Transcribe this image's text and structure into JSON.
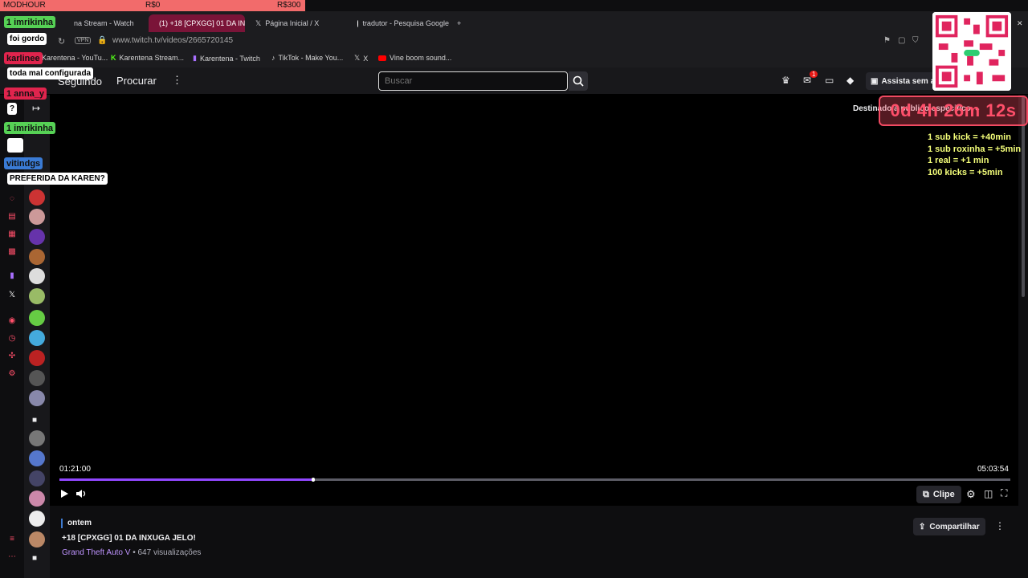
{
  "goal": {
    "left": "MODHOUR",
    "mid": "R$0",
    "right": "R$300"
  },
  "tabs": [
    {
      "label": "na Stream - Watch"
    },
    {
      "label": "(1) +18 [CPXGG] 01 DA IN"
    },
    {
      "label": "Página Inicial / X"
    },
    {
      "label": "tradutor - Pesquisa Google"
    }
  ],
  "url": {
    "vpn": "VPN",
    "address": "www.twitch.tv/videos/2665720145"
  },
  "bookmarks": [
    {
      "label": "Karentena - YouTu..."
    },
    {
      "label": "Karentena Stream..."
    },
    {
      "label": "Karentena - Twitch"
    },
    {
      "label": "TikTok - Make You..."
    },
    {
      "label": "X"
    },
    {
      "label": "Vine boom sound..."
    }
  ],
  "nav": {
    "following": "Seguindo",
    "browse": "Procurar",
    "search_placeholder": "Buscar",
    "notif_count": "1",
    "adfree": "Assista sem a"
  },
  "player": {
    "audience_label": "Destinado a público especifico",
    "time_current": "01:21:00",
    "time_total": "05:03:54",
    "progress_fraction": 0.267,
    "clip_label": "Clipe"
  },
  "video": {
    "date": "ontem",
    "title": "+18 [CPXGG] 01 DA INXUGA JELO!",
    "game": "Grand Theft Auto V",
    "views": " • 647 visualizações",
    "share_label": "Compartilhar"
  },
  "overlay": {
    "timer": "0d 4h 26m 12s",
    "rules": [
      "1 sub kick = +40min",
      "1 sub roxinha = +5min",
      "1 real = +1 min",
      "100 kicks = +5min"
    ]
  },
  "chat": [
    {
      "user": "imrikinha",
      "badge": "1",
      "color": "#56d155",
      "message": "foi gordo"
    },
    {
      "user": "karlinee",
      "badge": "",
      "color": "#e0244d",
      "message": "toda mal configurada"
    },
    {
      "user": "anna_y",
      "badge": "1",
      "color": "#e0244d",
      "message": "?"
    },
    {
      "user": "imrikinha",
      "badge": "1",
      "color": "#56d155",
      "message": ""
    },
    {
      "user": "vitindgs",
      "badge": "",
      "color": "#3a7bd5",
      "message": "PREFERIDA DA KAREN?"
    }
  ],
  "colors": {
    "accent": "#9147ff",
    "timer": "#ff4f6a",
    "rules": "#f5ff7a",
    "active_tab": "#7a1438"
  }
}
